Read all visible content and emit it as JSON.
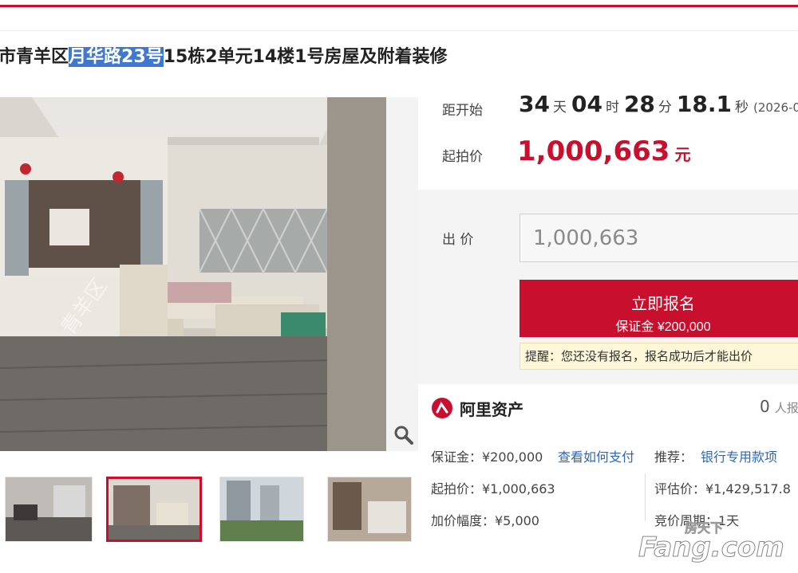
{
  "page": {
    "title_prefix": "市青羊区",
    "title_highlight": "月华路23号",
    "title_suffix": "15栋2单元14楼1号房屋及附着装修"
  },
  "countdown": {
    "label": "距开始",
    "days": "34",
    "days_unit": "天",
    "hours": "04",
    "hours_unit": "时",
    "minutes": "28",
    "minutes_unit": "分",
    "seconds": "18.1",
    "seconds_unit": "秒",
    "date_partial": "(2026-0"
  },
  "start_price": {
    "label": "起拍价",
    "value": "1,000,663",
    "unit": "元"
  },
  "bid": {
    "label": "出 价",
    "input_value": "1,000,663",
    "signup_label": "立即报名",
    "deposit_label": "保证金 ¥200,000",
    "notice": "提醒：您还没有报名，报名成功后才能出价"
  },
  "platform": {
    "name": "阿里资产",
    "count": "0",
    "count_suffix": "人报"
  },
  "details": {
    "deposit": "保证金：¥200,000",
    "how_to_pay": "查看如何支付",
    "recommend_label": "推荐：",
    "recommend_link": "银行专用款项",
    "start_price": "起拍价：¥1,000,663",
    "appraisal": "评估价：¥1,429,517.8",
    "increment": "加价幅度：¥5,000",
    "cycle": "竞价周期：1天"
  },
  "image": {
    "watermark_text": "青羊区"
  },
  "watermark": {
    "text_cn": "房天下",
    "text_en": "Fang.com"
  },
  "colors": {
    "accent": "#c8102e",
    "link": "#2e67b2",
    "highlight": "#3f78d1"
  }
}
